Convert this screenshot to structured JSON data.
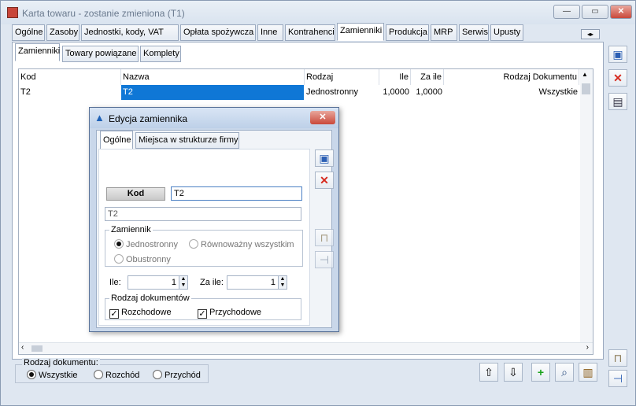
{
  "window": {
    "title": "Karta towaru - zostanie zmieniona (T1)"
  },
  "main_tabs": [
    "Ogólne",
    "Zasoby",
    "Jednostki, kody, VAT",
    "Opłata spożywcza",
    "Inne",
    "Kontrahenci",
    "Zamienniki",
    "Produkcja",
    "MRP",
    "Serwis",
    "Upusty"
  ],
  "sub_tabs": [
    "Zamienniki",
    "Towary powiązane",
    "Komplety"
  ],
  "grid": {
    "columns": [
      "Kod",
      "Nazwa",
      "Rodzaj",
      "Ile",
      "Za ile",
      "Rodzaj Dokumentu"
    ],
    "rows": [
      [
        "T2",
        "T2",
        "Jednostronny",
        "1,0000",
        "1,0000",
        "Wszystkie"
      ]
    ]
  },
  "doc_filter": {
    "label": "Rodzaj dokumentu:",
    "options": [
      "Wszystkie",
      "Rozchód",
      "Przychód"
    ],
    "selected": "Wszystkie"
  },
  "dialog": {
    "title": "Edycja zamiennika",
    "tabs": [
      "Ogólne",
      "Miejsca w strukturze firmy"
    ],
    "kod_button": "Kod",
    "kod_value": "T2",
    "name_value": "T2",
    "zamiennik_group": "Zamiennik",
    "options": [
      "Jednostronny",
      "Równoważny wszystkim",
      "Obustronny"
    ],
    "ile_label": "Ile:",
    "ile_value": "1",
    "za_ile_label": "Za ile:",
    "za_ile_value": "1",
    "doc_group": "Rodzaj dokumentów",
    "checks": [
      "Rozchodowe",
      "Przychodowe"
    ]
  }
}
